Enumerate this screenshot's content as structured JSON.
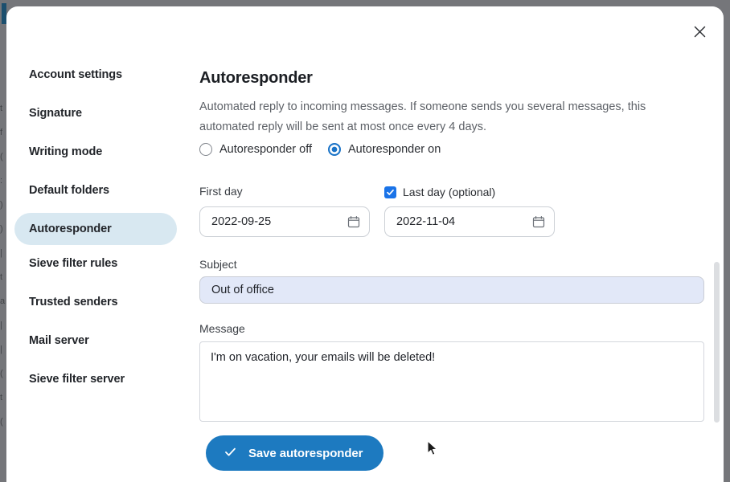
{
  "backdrop": {
    "fragments": [
      "t",
      "f",
      "(",
      "",
      ":",
      ")",
      ")",
      "",
      "|",
      "t",
      "a",
      "|",
      "|",
      "",
      "(",
      "t",
      "",
      "("
    ]
  },
  "modal": {
    "close_label": "×",
    "close_icon": "close-icon"
  },
  "sidebar": {
    "items": [
      {
        "label": "Account settings",
        "active": false
      },
      {
        "label": "Signature",
        "active": false
      },
      {
        "label": "Writing mode",
        "active": false
      },
      {
        "label": "Default folders",
        "active": false
      },
      {
        "label": "Autoresponder",
        "active": true
      },
      {
        "label": "Sieve filter rules",
        "active": false
      },
      {
        "label": "Trusted senders",
        "active": false
      },
      {
        "label": "Mail server",
        "active": false
      },
      {
        "label": "Sieve filter server",
        "active": false
      }
    ]
  },
  "main": {
    "title": "Autoresponder",
    "description": "Automated reply to incoming messages. If someone sends you several messages, this automated reply will be sent at most once every 4 days.",
    "radio": {
      "off_label": "Autoresponder off",
      "on_label": "Autoresponder on",
      "selected": "on"
    },
    "first_day": {
      "label": "First day",
      "value": "2022-09-25",
      "icon": "calendar-icon"
    },
    "last_day": {
      "label": "Last day (optional)",
      "checked": true,
      "value": "2022-11-04",
      "icon": "calendar-icon"
    },
    "subject": {
      "label": "Subject",
      "value": "Out of office",
      "placeholder": ""
    },
    "message": {
      "label": "Message",
      "value": "I'm on vacation, your emails will be deleted!",
      "placeholder": ""
    },
    "save": {
      "label": "Save autoresponder",
      "icon": "check-icon"
    }
  },
  "colors": {
    "accent": "#1d7ac0",
    "active_pill": "#d8e8f1",
    "subject_fill": "#e2e8f8",
    "checkbox": "#1a73e8"
  }
}
